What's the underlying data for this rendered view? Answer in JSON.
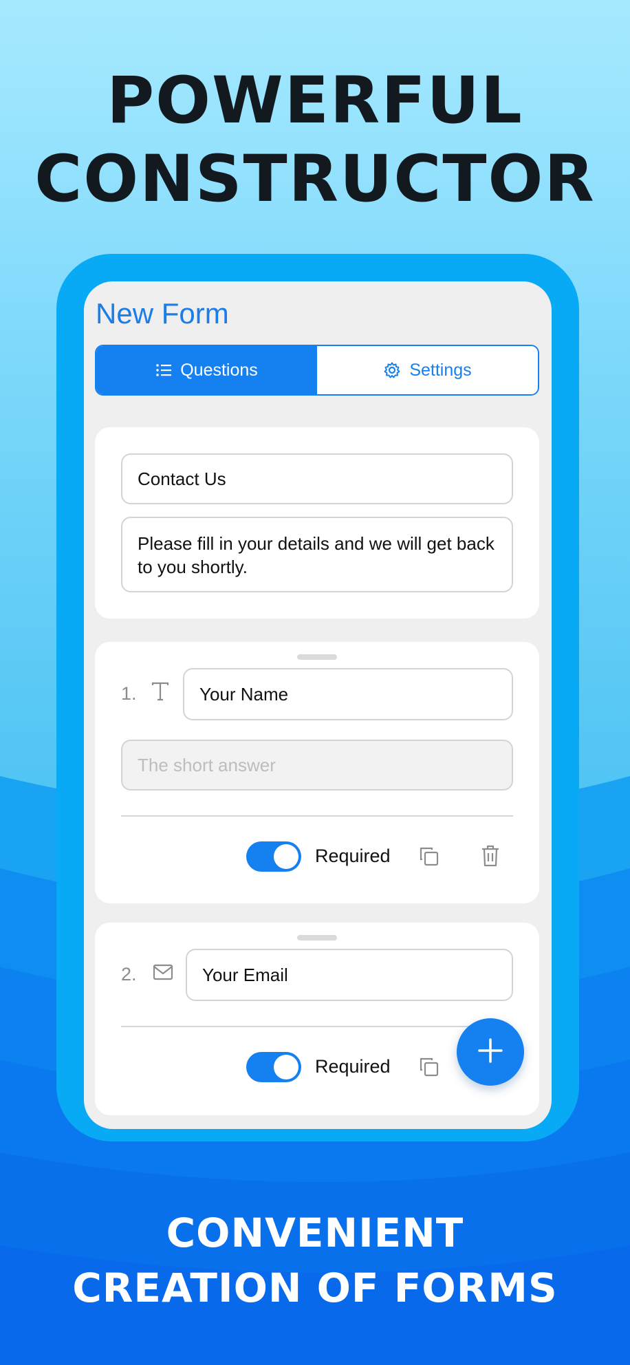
{
  "headline": {
    "line1": "POWERFUL",
    "line2": "CONSTRUCTOR"
  },
  "footer": {
    "line1": "CONVENIENT",
    "line2": "CREATION OF FORMS"
  },
  "form": {
    "title": "New Form",
    "tabs": [
      {
        "label": "Questions",
        "icon": "list-icon",
        "active": true
      },
      {
        "label": "Settings",
        "icon": "gear-icon",
        "active": false
      }
    ],
    "header_card": {
      "title_value": "Contact Us",
      "description_value": "Please fill in your details and we will get back to you shortly."
    },
    "questions": [
      {
        "number": "1.",
        "type_icon": "text-type-icon",
        "title_value": "Your Name",
        "answer_placeholder": "The short answer",
        "required_label": "Required",
        "required": true
      },
      {
        "number": "2.",
        "type_icon": "email-type-icon",
        "title_value": "Your Email",
        "required_label": "Required",
        "required": true
      }
    ],
    "fab_icon": "plus-icon"
  },
  "colors": {
    "accent": "#1580f0",
    "phone_frame": "#08aaf6",
    "title": "#1a7de8"
  }
}
